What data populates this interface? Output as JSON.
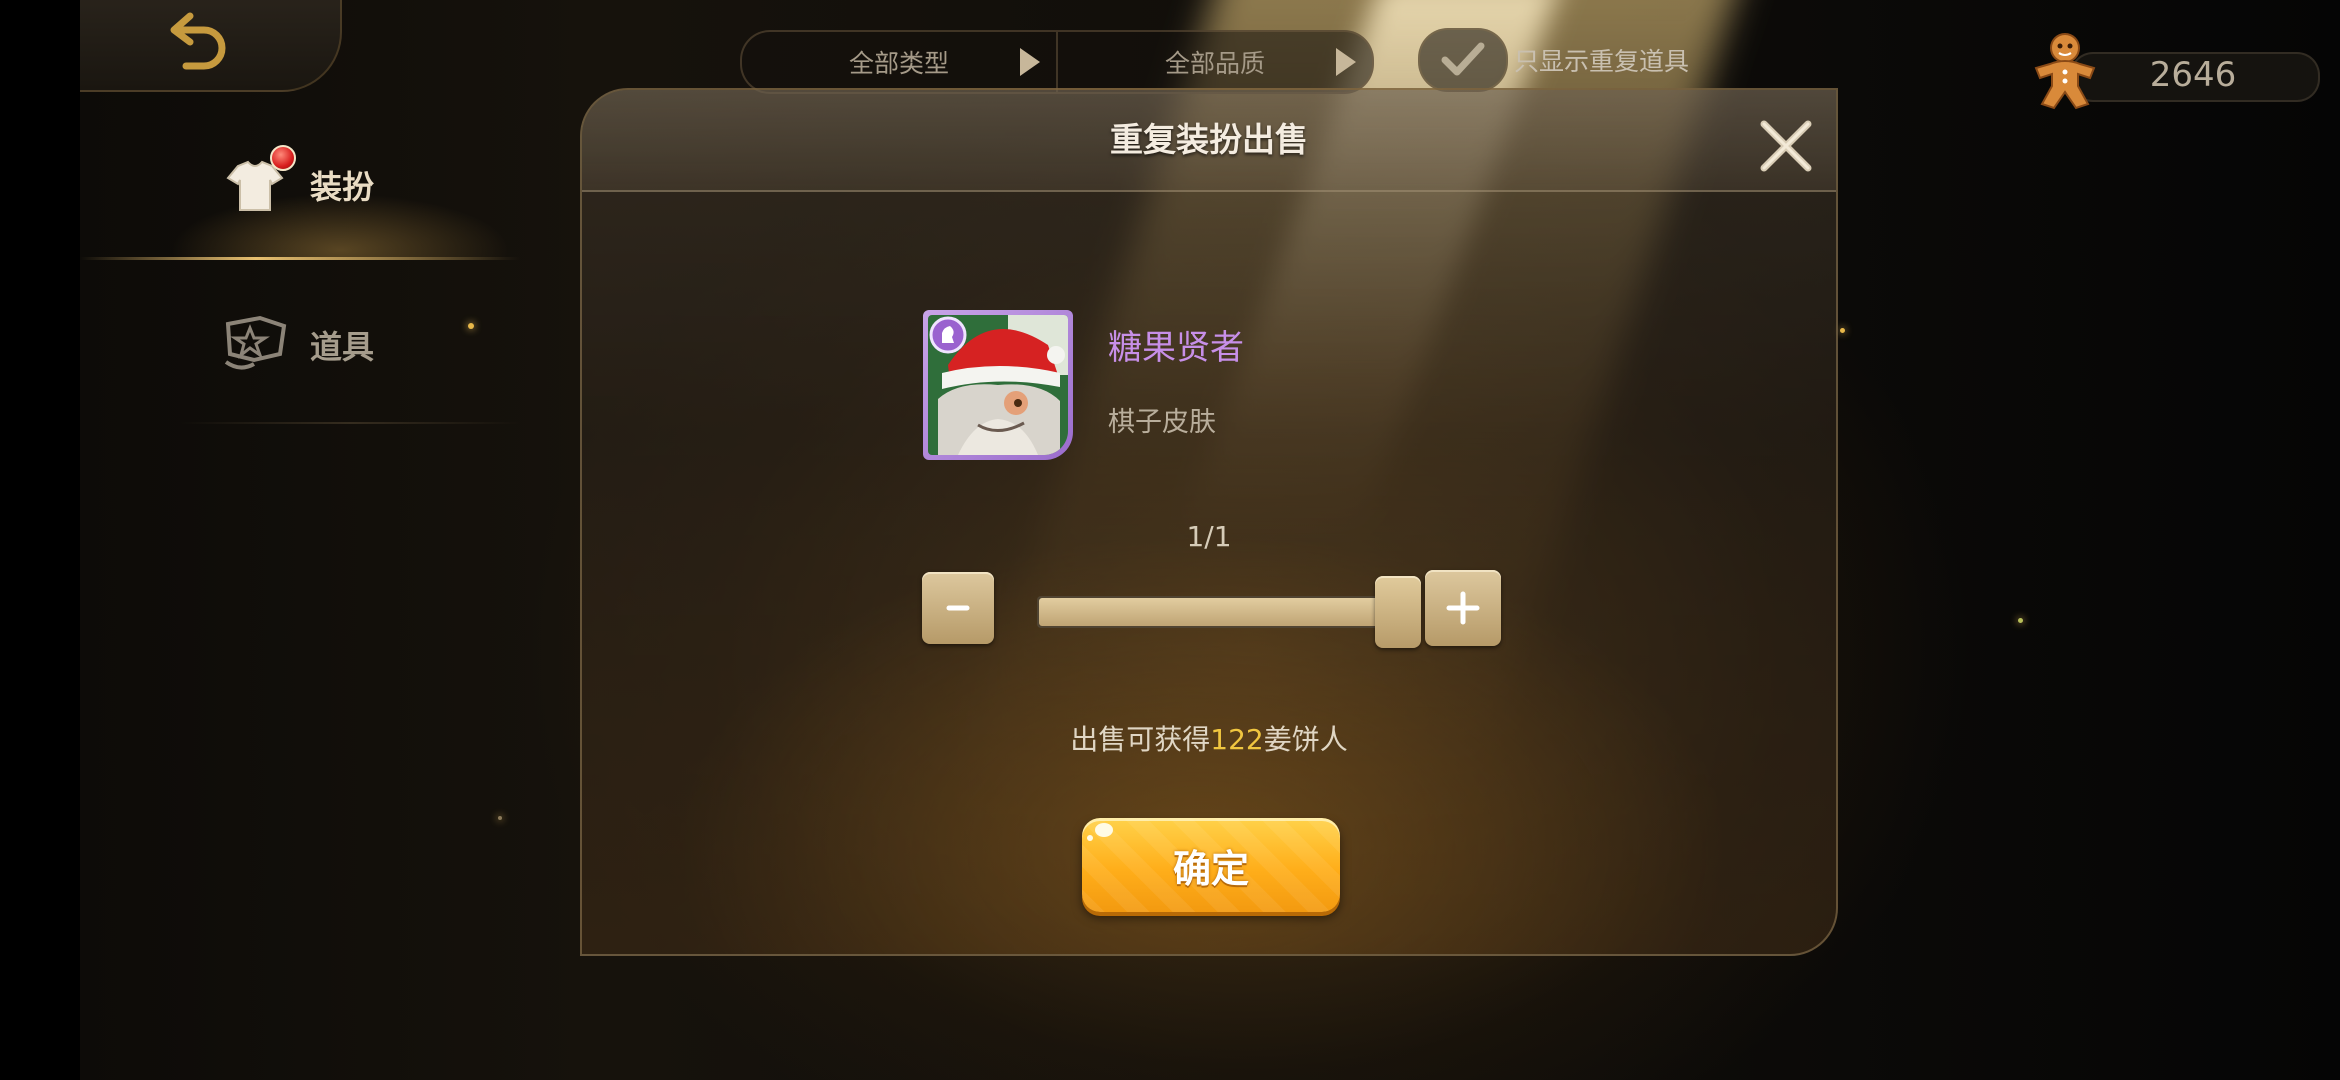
{
  "sidebar": {
    "items": [
      {
        "label": "装扮",
        "icon": "outfit-icon",
        "active": true,
        "has_notification": true
      },
      {
        "label": "道具",
        "icon": "item-icon",
        "active": false,
        "has_notification": false
      }
    ]
  },
  "filters": {
    "type_label": "全部类型",
    "quality_label": "全部品质",
    "duplicates_only_label": "只显示重复道具",
    "duplicates_only_checked": true
  },
  "currency": {
    "icon": "gingerbread-icon",
    "amount": "2646"
  },
  "modal": {
    "title": "重复装扮出售",
    "item": {
      "name": "糖果贤者",
      "type": "棋子皮肤",
      "rarity_color": "#b48ae0",
      "name_color": "#c78fe8"
    },
    "quantity": {
      "display": "1/1",
      "current": 1,
      "max": 1
    },
    "reward": {
      "prefix": "出售可获得",
      "amount": "122",
      "suffix": "姜饼人",
      "amount_color": "#f0c640"
    },
    "confirm_label": "确定"
  },
  "colors": {
    "accent_gold": "#e8c070",
    "confirm_orange": "#ffae1a"
  }
}
